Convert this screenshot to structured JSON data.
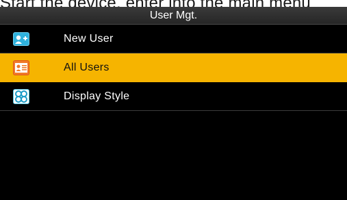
{
  "document": {
    "text_above": "Start the device, enter into the main menu"
  },
  "screen": {
    "header_title": "User Mgt.",
    "menu": [
      {
        "label": "New User",
        "icon": "add-user-icon",
        "selected": false
      },
      {
        "label": "All Users",
        "icon": "user-list-icon",
        "selected": true
      },
      {
        "label": "Display Style",
        "icon": "display-style-icon",
        "selected": false
      }
    ]
  },
  "colors": {
    "background": "#000000",
    "header": "#2e2e2e",
    "selected": "#f6b400",
    "text": "#ffffff"
  }
}
